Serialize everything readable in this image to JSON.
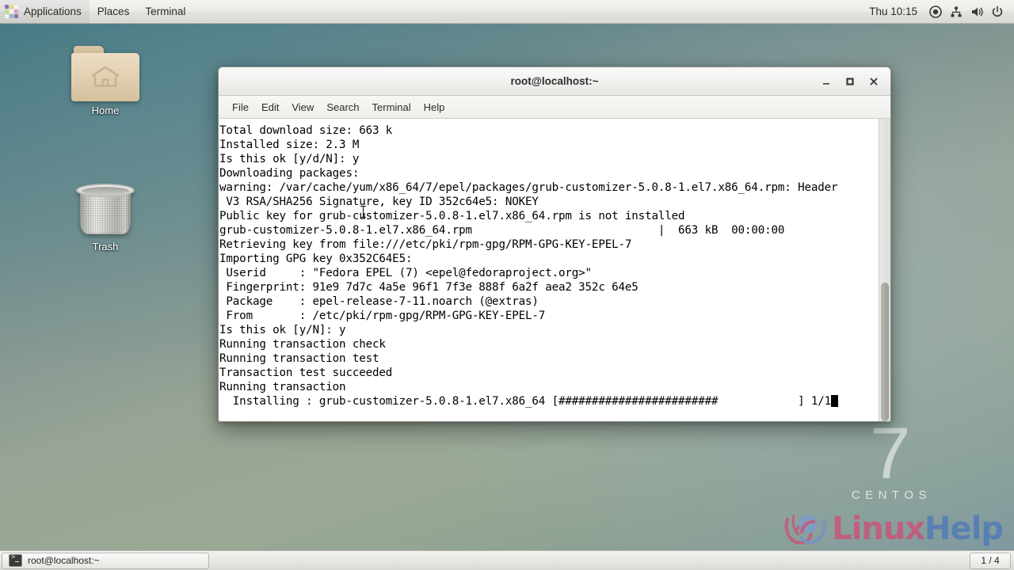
{
  "top_panel": {
    "apps_label": "Applications",
    "places_label": "Places",
    "terminal_label": "Terminal",
    "clock": "Thu 10:15",
    "tray": [
      {
        "name": "accessibility-icon"
      },
      {
        "name": "network-icon"
      },
      {
        "name": "volume-icon"
      },
      {
        "name": "power-icon"
      }
    ]
  },
  "desktop": {
    "home_label": "Home",
    "trash_label": "Trash",
    "watermark": {
      "version": "7",
      "distro": "CENTOS"
    },
    "logo": {
      "part1": "Linux",
      "part2": "Help"
    }
  },
  "terminal": {
    "title": "root@localhost:~",
    "controls": {
      "minimize": "_",
      "maximize": "❑",
      "close": "✕"
    },
    "menus": [
      "File",
      "Edit",
      "View",
      "Search",
      "Terminal",
      "Help"
    ],
    "lines": [
      "Total download size: 663 k",
      "Installed size: 2.3 M",
      "Is this ok [y/d/N]: y",
      "Downloading packages:",
      "warning: /var/cache/yum/x86_64/7/epel/packages/grub-customizer-5.0.8-1.el7.x86_64.rpm: Header",
      " V3 RSA/SHA256 Signature, key ID 352c64e5: NOKEY",
      "Public key for grub-customizer-5.0.8-1.el7.x86_64.rpm is not installed",
      "grub-customizer-5.0.8-1.el7.x86_64.rpm                            |  663 kB  00:00:00",
      "Retrieving key from file:///etc/pki/rpm-gpg/RPM-GPG-KEY-EPEL-7",
      "Importing GPG key 0x352C64E5:",
      " Userid     : \"Fedora EPEL (7) <epel@fedoraproject.org>\"",
      " Fingerprint: 91e9 7d7c 4a5e 96f1 7f3e 888f 6a2f aea2 352c 64e5",
      " Package    : epel-release-7-11.noarch (@extras)",
      " From       : /etc/pki/rpm-gpg/RPM-GPG-KEY-EPEL-7",
      "Is this ok [y/N]: y",
      "Running transaction check",
      "Running transaction test",
      "Transaction test succeeded",
      "Running transaction",
      "  Installing : grub-customizer-5.0.8-1.el7.x86_64 [########################            ] 1/1"
    ]
  },
  "taskbar": {
    "window_button": "root@localhost:~",
    "workspace": "1 / 4"
  },
  "colors": {
    "accent_pink": "#e03a6d",
    "accent_blue": "#3f6fc4",
    "terminal_bg": "#ffffff",
    "terminal_fg": "#000000"
  }
}
